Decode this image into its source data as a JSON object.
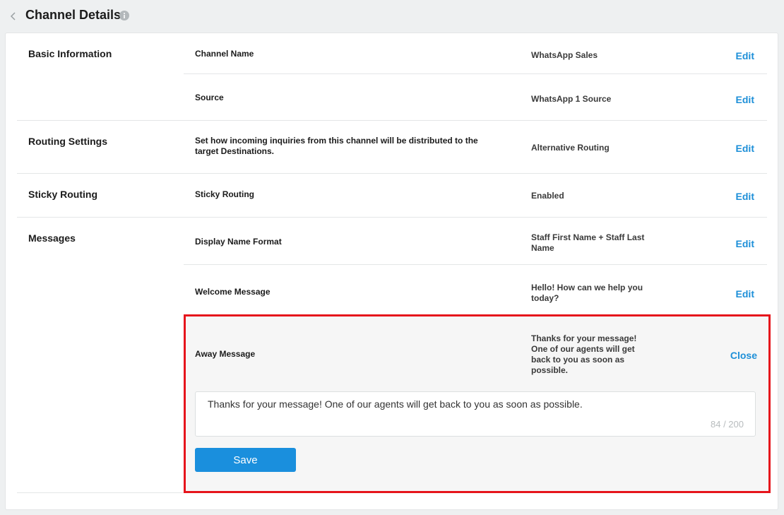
{
  "header": {
    "title": "Channel Details"
  },
  "sections": {
    "basic": {
      "label": "Basic Information",
      "channel_name_label": "Channel Name",
      "channel_name_value": "WhatsApp Sales",
      "source_label": "Source",
      "source_value": "WhatsApp 1 Source"
    },
    "routing": {
      "label": "Routing Settings",
      "description": "Set how incoming inquiries from this channel will be distributed to the target Destinations.",
      "value": "Alternative Routing"
    },
    "sticky": {
      "label": "Sticky Routing",
      "field_label": "Sticky Routing",
      "value": "Enabled"
    },
    "messages": {
      "label": "Messages",
      "display_name_label": "Display Name Format",
      "display_name_value": "Staff First Name + Staff Last Name",
      "welcome_label": "Welcome Message",
      "welcome_value": "Hello! How can we help you today?",
      "away_label": "Away Message",
      "away_value": "Thanks for your message! One of our agents will get back to you as soon as possible.",
      "away_input_value": "Thanks for your message! One of our agents will get back to you as soon as possible.",
      "char_counter": "84 / 200"
    }
  },
  "actions": {
    "edit_label": "Edit",
    "close_label": "Close",
    "save_label": "Save"
  },
  "colors": {
    "accent": "#1d8fd8",
    "button": "#1a8fdd",
    "highlight_border": "#e6151c"
  },
  "icons": {
    "back": "chevron-left-icon",
    "info": "info-icon"
  }
}
